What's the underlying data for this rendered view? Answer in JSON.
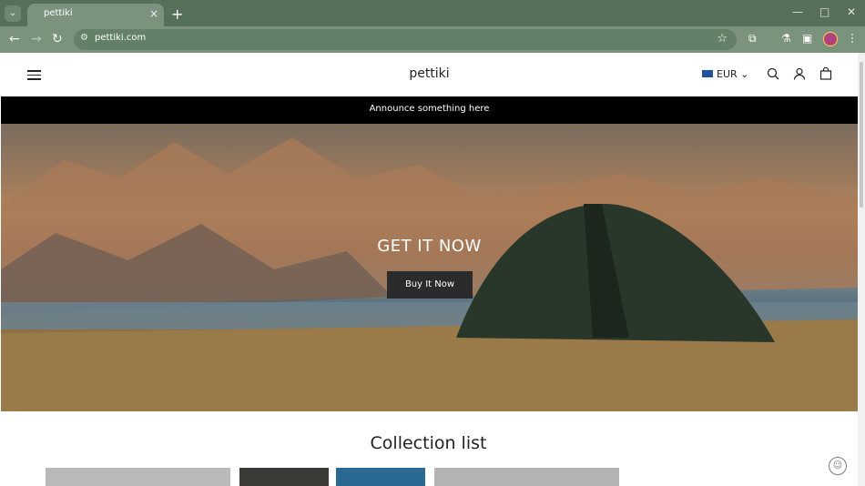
{
  "browser": {
    "tab_title": "pettiki",
    "tab_close": "×",
    "new_tab": "+",
    "url": "pettiki.com",
    "window_controls": [
      "—",
      "□",
      "✕"
    ]
  },
  "header": {
    "logo": "pettiki",
    "currency": "EUR",
    "currency_chevron": "⌄"
  },
  "announcement": "Announce something here",
  "hero": {
    "title": "GET IT NOW",
    "button": "Buy It Now"
  },
  "collection": {
    "title": "Collection list"
  },
  "colors": {
    "chrome": "#56705a",
    "announcement_bg": "#000000",
    "button_bg": "#2b2b2b"
  }
}
